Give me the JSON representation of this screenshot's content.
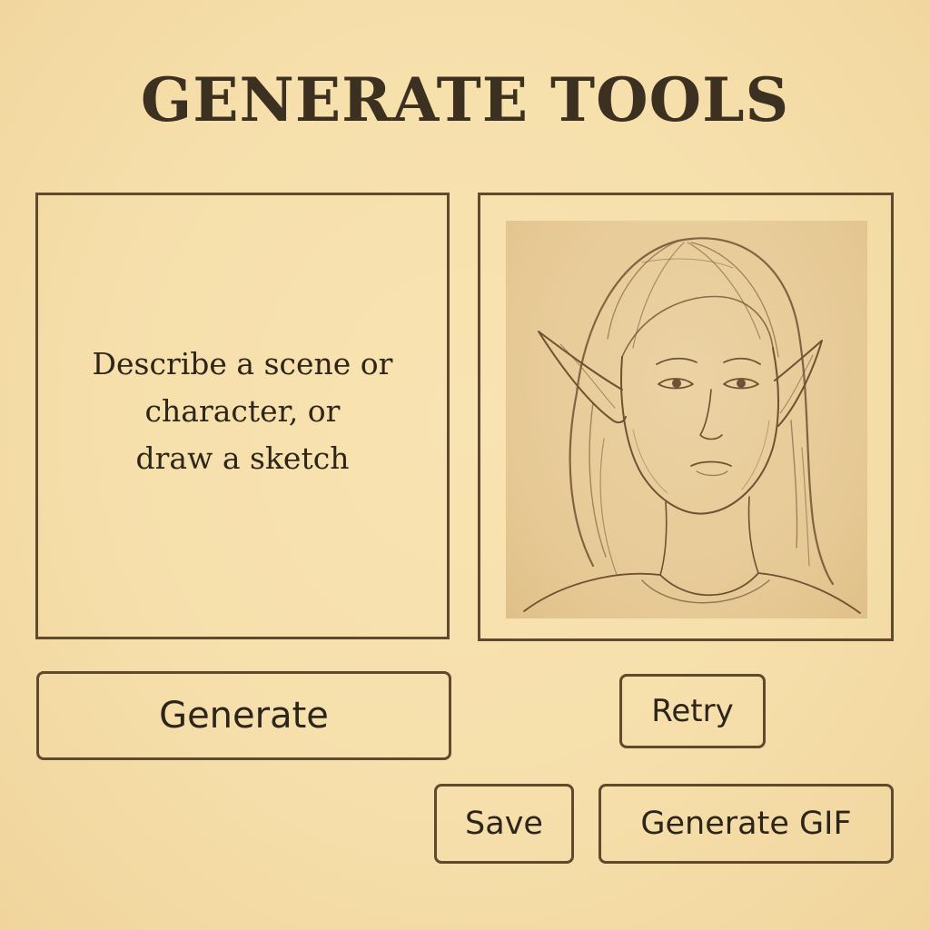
{
  "page": {
    "title": "GENERATE TOOLS"
  },
  "prompt_panel": {
    "placeholder_lines": [
      "Describe a scene or",
      "character, or",
      "draw a sketch"
    ]
  },
  "preview": {
    "image_description": "elf-portrait-sketch",
    "colors": {
      "frame_background": "#e6c995",
      "stroke": "#6e5233"
    }
  },
  "actions": {
    "generate_label": "Generate",
    "retry_label": "Retry",
    "save_label": "Save",
    "gif_label": "Generate GIF"
  },
  "theme": {
    "background": "#f6dfab",
    "border": "#5f4a2e",
    "text": "#3c3121"
  }
}
